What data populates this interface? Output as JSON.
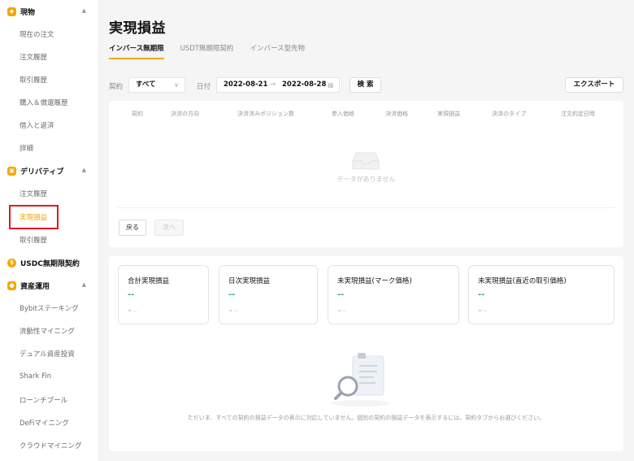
{
  "sidebar": {
    "spot": {
      "label": "現物"
    },
    "spot_items": [
      {
        "label": "現在の注文"
      },
      {
        "label": "注文履歴"
      },
      {
        "label": "取引履歴"
      },
      {
        "label": "購入＆償還履歴"
      },
      {
        "label": "借入と返済"
      },
      {
        "label": "詳細"
      }
    ],
    "derivatives": {
      "label": "デリバティブ"
    },
    "derivative_items": [
      {
        "label": "注文履歴"
      },
      {
        "label": "実現損益"
      },
      {
        "label": "取引履歴"
      }
    ],
    "usdc": {
      "label": "USDC無期限契約"
    },
    "asset_mgmt": {
      "label": "資産運用"
    },
    "asset_items": [
      {
        "label": "Bybitステーキング"
      },
      {
        "label": "流動性マイニング"
      },
      {
        "label": "デュアル資産投資"
      },
      {
        "label": "Shark Fin"
      },
      {
        "label": "ローンチプール"
      },
      {
        "label": "DeFiマイニング"
      },
      {
        "label": "クラウドマイニング"
      }
    ]
  },
  "page": {
    "title": "実現損益",
    "tabs": [
      {
        "label": "インバース無期限"
      },
      {
        "label": "USDT無期限契約"
      },
      {
        "label": "インバース型先物"
      }
    ]
  },
  "filters": {
    "contract_label": "契約",
    "contract_value": "すべて",
    "date_label": "日付",
    "date_from": "2022-08-21",
    "date_arrow": "→",
    "date_to": "2022-08-28",
    "search_label": "検 索",
    "export_label": "エクスポート"
  },
  "table": {
    "columns": [
      "契約",
      "決済の方向",
      "決済済みポジション数",
      "参入価格",
      "決済価格",
      "実現損益",
      "決済のタイプ",
      "注文約定日時"
    ],
    "empty_text": "データがありません",
    "back_label": "戻る",
    "next_label": "次へ"
  },
  "stats": [
    {
      "title": "合計実現損益",
      "value": "--",
      "sub": "≈ --"
    },
    {
      "title": "日次実現損益",
      "value": "--",
      "sub": "≈ --"
    },
    {
      "title": "未実現損益(マーク価格)",
      "value": "--",
      "sub": "≈ --"
    },
    {
      "title": "未実現損益(直近の取引価格)",
      "value": "--",
      "sub": "≈ --"
    }
  ],
  "notice": "ただいま、すべての契約の損益データの表示に対応していません。個別の契約の損益データを表示するには、契約タブからお選びください。",
  "colors": {
    "accent": "#f7a600",
    "positive": "#20b26c",
    "highlight": "#e0191f"
  }
}
